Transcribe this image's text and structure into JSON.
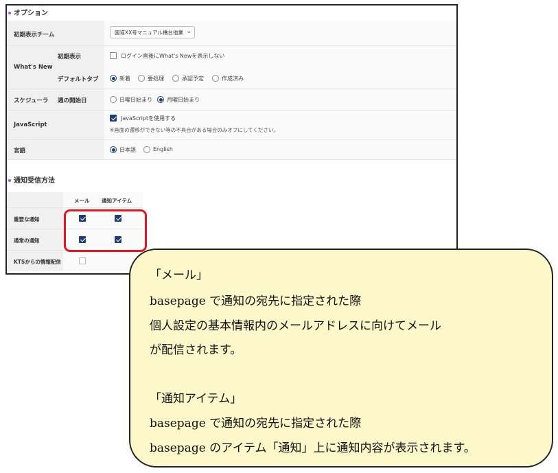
{
  "options": {
    "title": "オプション",
    "initial_team": {
      "label": "初期表示チーム",
      "value": "国道XX号マニュアル橋台他業"
    },
    "whats_new": {
      "label": "What's New",
      "initial_display": {
        "label": "初期表示",
        "checkbox_label": "ログイン直後にWhat's Newを表示しない",
        "checked": false
      },
      "default_tab": {
        "label": "デフォルトタブ",
        "options": [
          "新着",
          "要処理",
          "承認予定",
          "作成済み"
        ],
        "selected": "新着"
      }
    },
    "scheduler": {
      "label": "スケジューラ",
      "week_start": {
        "label": "週の開始日",
        "options": [
          "日曜日始まり",
          "月曜日始まり"
        ],
        "selected": "月曜日始まり"
      }
    },
    "javascript": {
      "label": "JavaScript",
      "checkbox_label": "JavaScriptを使用する",
      "checked": true,
      "note": "※画面の遷移ができない等の不具合がある場合のみオフにしてください。"
    },
    "language": {
      "label": "言語",
      "options": [
        "日本語",
        "English"
      ],
      "selected": "日本語"
    }
  },
  "notification": {
    "title": "通知受信方法",
    "columns": [
      "メール",
      "通知アイテム"
    ],
    "rows": [
      {
        "label": "重要な通知",
        "mail": true,
        "item": true
      },
      {
        "label": "通常の通知",
        "mail": true,
        "item": true
      },
      {
        "label": "KTSからの情報配信",
        "mail": false
      }
    ]
  },
  "callout": {
    "lines": [
      "「メール」",
      "basepage で通知の宛先に指定された際",
      "個人設定の基本情報内のメールアドレスに向けてメール",
      "が配信されます。",
      "",
      "「通知アイテム」",
      "basepage で通知の宛先に指定された際",
      "basepage のアイテム「通知」上に通知内容が表示されます。"
    ]
  }
}
